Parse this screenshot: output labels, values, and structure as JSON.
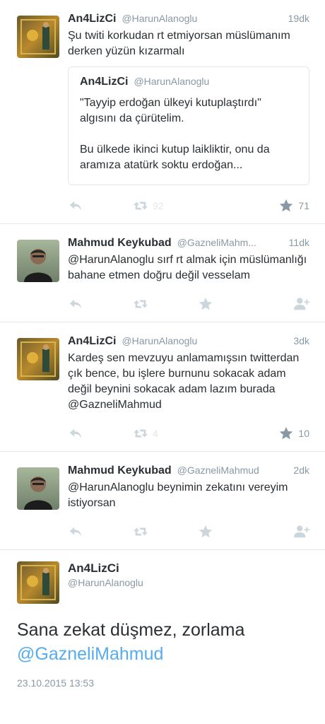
{
  "tweets": [
    {
      "name": "An4LizCi",
      "handle": "@HarunAlanoglu",
      "time": "19dk",
      "text": "Şu twiti korkudan rt etmiyorsan müslümanım derken yüzün kızarmalı",
      "quote": {
        "name": "An4LizCi",
        "handle": "@HarunAlanoglu",
        "p1": "\"Tayyip erdoğan ülkeyi kutuplaştırdı\" algısını da çürütelim.",
        "p2": "Bu ülkede ikinci kutup laikliktir, onu da aramıza atatürk soktu erdoğan..."
      },
      "retweets": "92",
      "likes": "71"
    },
    {
      "name": "Mahmud Keykubad",
      "handle": "@GazneliMahm...",
      "time": "11dk",
      "text": "@HarunAlanoglu sırf rt almak için müslümanlığı bahane etmen doğru değil vesselam"
    },
    {
      "name": "An4LizCi",
      "handle": "@HarunAlanoglu",
      "time": "3dk",
      "text": "Kardeş sen mevzuyu anlamamışsın twitterdan çık bence, bu işlere burnunu sokacak adam değil beynini sokacak adam lazım burada @GazneliMahmud",
      "retweets": "4",
      "likes": "10"
    },
    {
      "name": "Mahmud Keykubad",
      "handle": "@GazneliMahmud",
      "time": "2dk",
      "text": "@HarunAlanoglu beynimin zekatını vereyim istiyorsan"
    }
  ],
  "detail": {
    "name": "An4LizCi",
    "handle": "@HarunAlanoglu",
    "text": "Sana zekat düşmez, zorlama",
    "mention": "@GazneliMahmud",
    "date": "23.10.2015 13:53"
  },
  "icons": {
    "reply": "reply-icon",
    "retweet": "retweet-icon",
    "like": "star-icon",
    "follow": "follow-icon"
  },
  "colors": {
    "text": "#292f33",
    "muted": "#8899a6",
    "icon": "#ccd6dd",
    "link": "#55acee",
    "border": "#e1e8ed"
  }
}
